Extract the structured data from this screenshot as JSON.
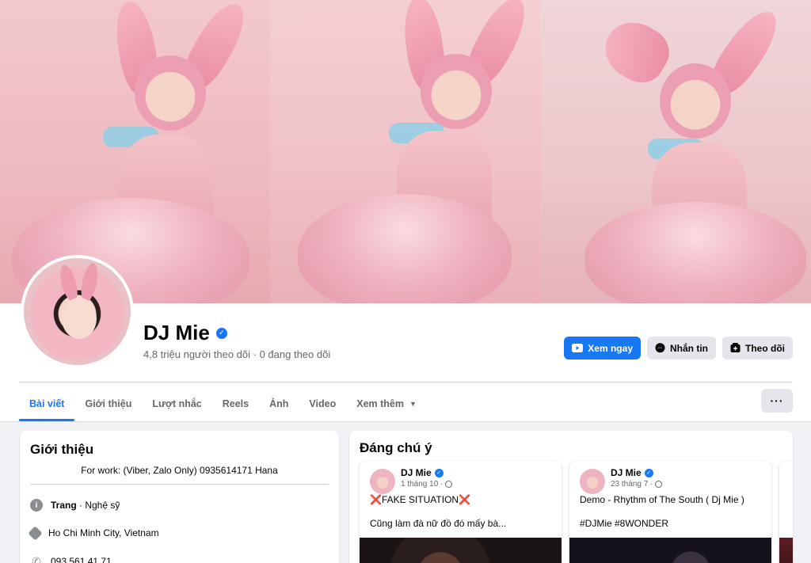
{
  "profile": {
    "name": "DJ Mie",
    "stats": "4,8 triệu người theo dõi · 0 đang theo dõi"
  },
  "actions": {
    "watch_label": "Xem ngay",
    "message_label": "Nhắn tin",
    "follow_label": "Theo dõi"
  },
  "tabs": [
    {
      "label": "Bài viết",
      "active": true
    },
    {
      "label": "Giới thiệu"
    },
    {
      "label": "Lượt nhắc"
    },
    {
      "label": "Reels"
    },
    {
      "label": "Ảnh"
    },
    {
      "label": "Video"
    },
    {
      "label": "Xem thêm"
    }
  ],
  "more_button": "···",
  "intro": {
    "title": "Giới thiệu",
    "bio": "For work: (Viber, Zalo Only) 0935614171 Hana",
    "page_type_label": "Trang",
    "page_type_value": " · Nghệ sỹ",
    "location": "Ho Chi Minh City, Vietnam",
    "phone": "093 561 41 71"
  },
  "featured": {
    "title": "Đáng chú ý",
    "posts": [
      {
        "author": "DJ Mie",
        "date": "1 tháng 10 ·",
        "line1": "❌FAKE SITUATION❌",
        "line2": "Cũng làm đà nữ đồ đó mấy bà..."
      },
      {
        "author": "DJ Mie",
        "date": "23 tháng 7 ·",
        "line1": "Demo - Rhythm of The South ( Dj Mie )",
        "line2": "#DJMie #8WONDER"
      }
    ]
  },
  "colors": {
    "accent": "#1877f2",
    "secondary_button": "#e4e6eb",
    "background": "#f0f2f5"
  }
}
